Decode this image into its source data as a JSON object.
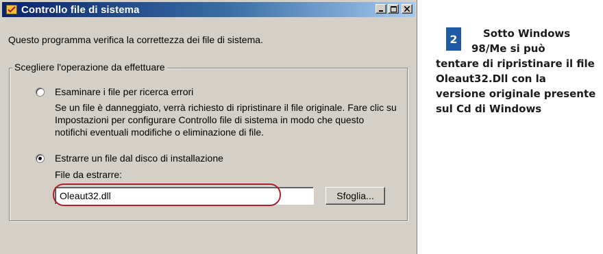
{
  "window": {
    "title": "Controllo file di sistema",
    "icon": "system-file-checker-icon",
    "buttons": [
      "minimize",
      "maximize",
      "close"
    ]
  },
  "intro_text": "Questo programma verifica la correttezza dei file di sistema.",
  "group": {
    "legend": "Scegliere l'operazione da effettuare",
    "option_scan": {
      "label": "Esaminare i file per ricerca errori",
      "checked": false,
      "description": "Se un file è danneggiato, verrà richiesto di ripristinare il file originale. Fare clic su Impostazioni per configurare Controllo file di sistema in modo che questo notifichi eventuali modifiche o eliminazione di file."
    },
    "option_extract": {
      "label": "Estrarre un file dal disco di installazione",
      "checked": true
    },
    "file_label": "File da estrarre:",
    "file_value": "Oleaut32.dll",
    "browse_label": "Sfoglia..."
  },
  "caption": {
    "number": "2",
    "line1": "Sotto Windows",
    "line2": "98/Me si può",
    "rest": "tentare di ripristinare il file Oleaut32.Dll con la versione originale presente sul Cd di Windows"
  },
  "colors": {
    "titlebar_start": "#0a246a",
    "titlebar_end": "#a6caf0",
    "window_face": "#d4d0c8",
    "highlight_oval": "#b0202a",
    "badge": "#1f5aa6"
  }
}
